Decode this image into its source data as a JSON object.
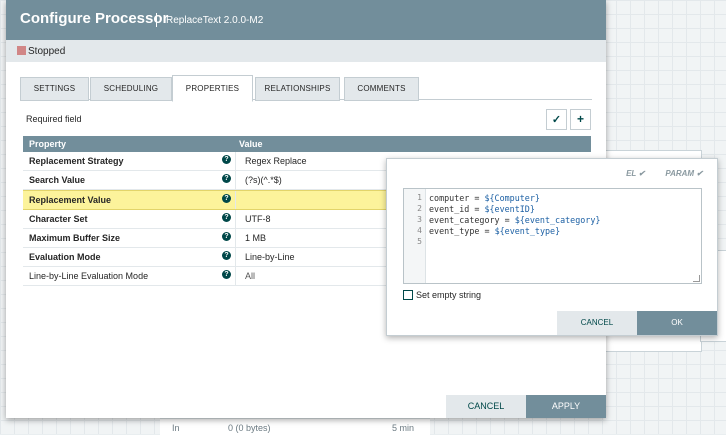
{
  "dialog": {
    "title": "Configure Processor",
    "subtitle": "ReplaceText 2.0.0-M2",
    "status": "Stopped",
    "tabs": [
      "SETTINGS",
      "SCHEDULING",
      "PROPERTIES",
      "RELATIONSHIPS",
      "COMMENTS"
    ],
    "active_tab": "PROPERTIES",
    "required_field": "Required field",
    "table_headers": {
      "property": "Property",
      "value": "Value"
    },
    "properties": [
      {
        "name": "Replacement Strategy",
        "value": "Regex Replace",
        "required": true
      },
      {
        "name": "Search Value",
        "value": "(?s)(^.*$)",
        "required": true
      },
      {
        "name": "Replacement Value",
        "value": "",
        "required": true,
        "selected": true
      },
      {
        "name": "Character Set",
        "value": "UTF-8",
        "required": true
      },
      {
        "name": "Maximum Buffer Size",
        "value": "1 MB",
        "required": true
      },
      {
        "name": "Evaluation Mode",
        "value": "Line-by-Line",
        "required": true
      },
      {
        "name": "Line-by-Line Evaluation Mode",
        "value": "All",
        "required": false
      }
    ],
    "cancel_label": "CANCEL",
    "apply_label": "APPLY"
  },
  "editor": {
    "flag_el": "EL ✔",
    "flag_param": "PARAM ✔",
    "lines": [
      {
        "n": "1",
        "prefix": "computer = ",
        "expr": "${Computer}"
      },
      {
        "n": "2",
        "prefix": "event_id = ",
        "expr": "${eventID}"
      },
      {
        "n": "3",
        "prefix": "event_category = ",
        "expr": "${event_category}"
      },
      {
        "n": "4",
        "prefix": "event_type = ",
        "expr": "${event_type}"
      },
      {
        "n": "5",
        "prefix": "",
        "expr": ""
      }
    ],
    "empty_string_label": "Set empty string",
    "cancel_label": "CANCEL",
    "ok_label": "OK"
  },
  "background": {
    "footer_in": "In",
    "footer_bytes": "0 (0 bytes)",
    "footer_time": "5 min"
  },
  "colors": {
    "header": "#728e9b",
    "selected_row": "#fcf39b",
    "stopped": "#d18686",
    "accent": "#004849"
  }
}
